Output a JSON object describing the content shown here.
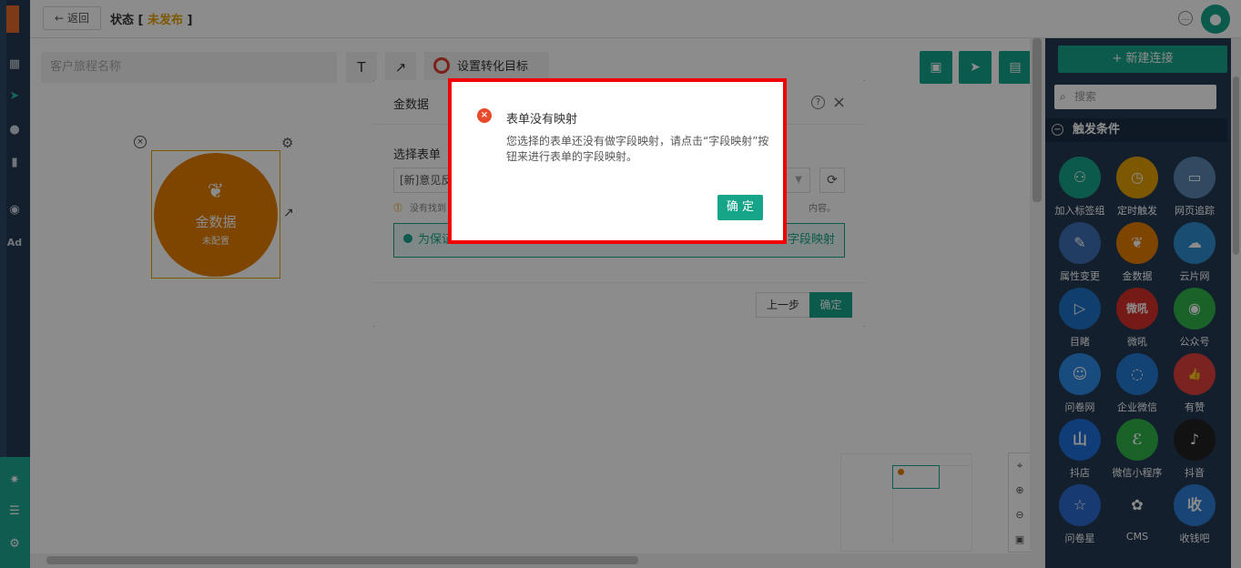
{
  "header": {
    "back_label": "返回",
    "status_label": "状态 [",
    "status_value": "未发布",
    "status_close": "]"
  },
  "toolbar": {
    "journey_name_placeholder": "客户旅程名称",
    "text_tool": "T",
    "arrow_tool": "↗",
    "goal_label": "设置转化目标"
  },
  "canvas": {
    "node": {
      "title": "金数据",
      "subtitle": "未配置"
    }
  },
  "right_panel": {
    "new_connection_label": "新建连接",
    "search_placeholder": "搜索",
    "section_title": "触发条件",
    "tiles": [
      {
        "label": "加入标签组",
        "color": "#17a589",
        "icon": "person-plus-icon"
      },
      {
        "label": "定时触发",
        "color": "#e6a000",
        "icon": "clock-icon"
      },
      {
        "label": "网页追踪",
        "color": "#5b86b3",
        "icon": "webpage-icon"
      },
      {
        "label": "属性变更",
        "color": "#3d6fb6",
        "icon": "edit-icon"
      },
      {
        "label": "金数据",
        "color": "#e67e00",
        "icon": "sprout-icon"
      },
      {
        "label": "云片网",
        "color": "#2f8fd0",
        "icon": "cloud-icon"
      },
      {
        "label": "目睹",
        "color": "#1e73c8",
        "icon": "play-icon"
      },
      {
        "label": "微吼",
        "color": "#d63028",
        "icon": "vhall-icon"
      },
      {
        "label": "公众号",
        "color": "#2eb34a",
        "icon": "wechat-icon"
      },
      {
        "label": "问卷网",
        "color": "#2d8ae8",
        "icon": "survey-icon"
      },
      {
        "label": "企业微信",
        "color": "#2479d6",
        "icon": "wecom-icon"
      },
      {
        "label": "有赞",
        "color": "#e0413c",
        "icon": "thumb-icon"
      },
      {
        "label": "抖店",
        "color": "#1e6fd9",
        "icon": "doudian-icon"
      },
      {
        "label": "微信小程序",
        "color": "#2eb34a",
        "icon": "miniprogram-icon"
      },
      {
        "label": "抖音",
        "color": "#222222",
        "icon": "tiktok-icon"
      },
      {
        "label": "问卷星",
        "color": "#2d6bd0",
        "icon": "star-icon"
      },
      {
        "label": "CMS",
        "color": "#233a52",
        "icon": "cms-icon"
      },
      {
        "label": "收钱吧",
        "color": "#2d7fd6",
        "icon": "shouqianba-icon"
      }
    ]
  },
  "modal": {
    "title": "金数据",
    "select_form_label": "选择表单",
    "select_value": "[新]意见反",
    "hint_left": "没有找到",
    "hint_right": "内容。",
    "notice_text": "为保证",
    "notice_link": "字段映射",
    "prev_label": "上一步",
    "ok_label": "确定"
  },
  "alert": {
    "title": "表单没有映射",
    "message": "您选择的表单还没有做字段映射，请点击“字段映射”按钮来进行表单的字段映射。",
    "ok_label": "确 定"
  },
  "colors": {
    "accent": "#17a589",
    "sidebar_bg": "#233a52",
    "node_orange": "#e67e00",
    "error_red": "#e84b2c",
    "highlight_frame": "#f00000"
  }
}
